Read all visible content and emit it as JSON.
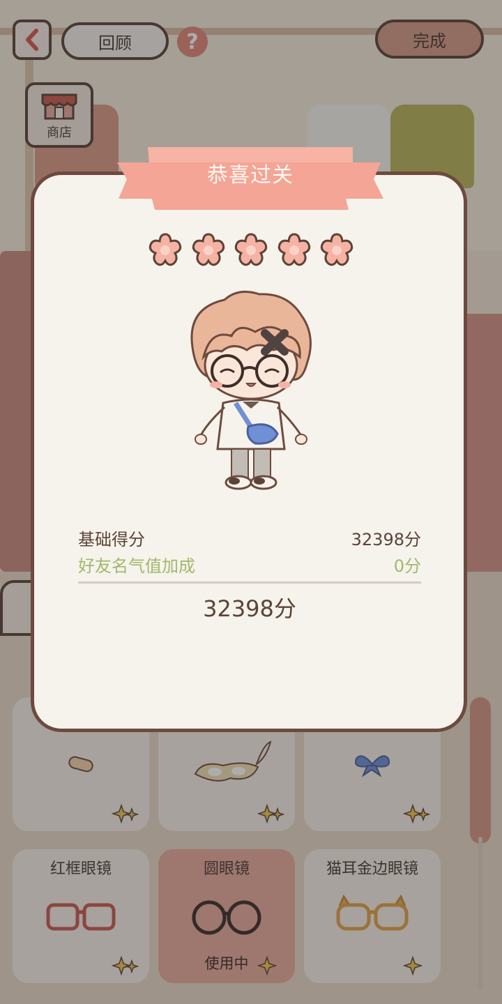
{
  "topbar": {
    "back_icon": "chevron-left-icon",
    "review_label": "回顾",
    "help_label": "?",
    "done_label": "完成",
    "shop_label": "商店"
  },
  "modal": {
    "title": "恭喜过关",
    "stars_earned": 5,
    "stars_total": 5,
    "base_score_label": "基础得分",
    "base_score_value": "32398分",
    "bonus_label": "好友名气值加成",
    "bonus_value": "0分",
    "total_value": "32398分"
  },
  "items": [
    {
      "name": "",
      "icon": "bandage-icon",
      "status": ""
    },
    {
      "name": "",
      "icon": "feather-mask-icon",
      "status": ""
    },
    {
      "name": "",
      "icon": "blue-bow-icon",
      "status": ""
    },
    {
      "name": "红框眼镜",
      "icon": "red-glasses-icon",
      "status": ""
    },
    {
      "name": "圆眼镜",
      "icon": "round-glasses-icon",
      "status": "使用中"
    },
    {
      "name": "猫耳金边眼镜",
      "icon": "cat-ear-glasses-icon",
      "status": ""
    }
  ],
  "colors": {
    "accent_pink": "#f2a494",
    "bonus_green": "#a2b86c",
    "outline_brown": "#5b4338",
    "active_card": "#e7a89b"
  }
}
